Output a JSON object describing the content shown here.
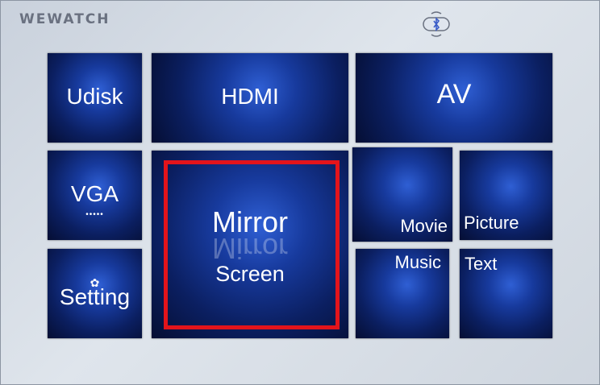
{
  "brand": "WEWATCH",
  "status": {
    "icon": "bluetooth-icon"
  },
  "tiles": {
    "udisk": "Udisk",
    "hdmi": "HDMI",
    "av": "AV",
    "vga": "VGA",
    "mirror_line1": "Mirror",
    "mirror_line2": "Screen",
    "movie": "Movie",
    "picture": "Picture",
    "music": "Music",
    "text": "Text",
    "setting": "Setting"
  },
  "selected_tile": "mirror-screen-tile",
  "colors": {
    "selection": "#e3141b",
    "tile_glow": "#2f5fd4",
    "tile_edge": "#050e33"
  }
}
